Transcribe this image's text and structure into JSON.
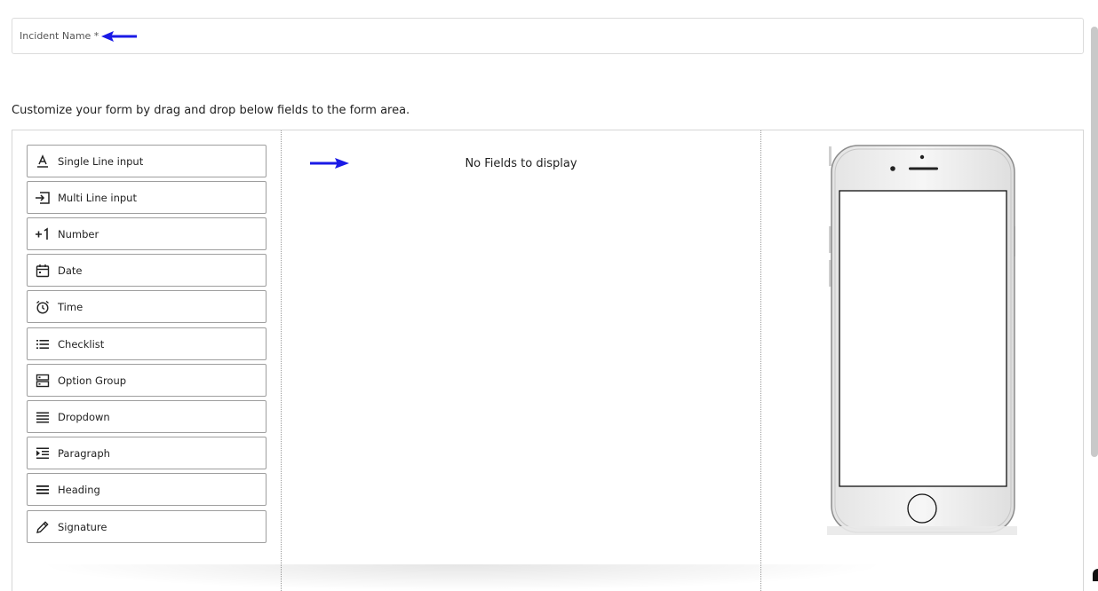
{
  "incident": {
    "label": "Incident Name *"
  },
  "hint": "Customize your form by drag and drop below fields to the form area.",
  "fields": [
    {
      "label": "Single Line input",
      "icon": "text-underline-icon"
    },
    {
      "label": "Multi Line input",
      "icon": "input-arrow-icon"
    },
    {
      "label": "Number",
      "icon": "plus-one-icon"
    },
    {
      "label": "Date",
      "icon": "calendar-icon"
    },
    {
      "label": "Time",
      "icon": "alarm-clock-icon"
    },
    {
      "label": "Checklist",
      "icon": "list-icon"
    },
    {
      "label": "Option Group",
      "icon": "option-group-icon"
    },
    {
      "label": "Dropdown",
      "icon": "lines-icon"
    },
    {
      "label": "Paragraph",
      "icon": "indent-icon"
    },
    {
      "label": "Heading",
      "icon": "heading-lines-icon"
    },
    {
      "label": "Signature",
      "icon": "pencil-icon"
    }
  ],
  "form_area": {
    "empty_message": "No Fields to display"
  },
  "colors": {
    "arrow": "#1a1ae6",
    "border": "#9e9e9e"
  }
}
